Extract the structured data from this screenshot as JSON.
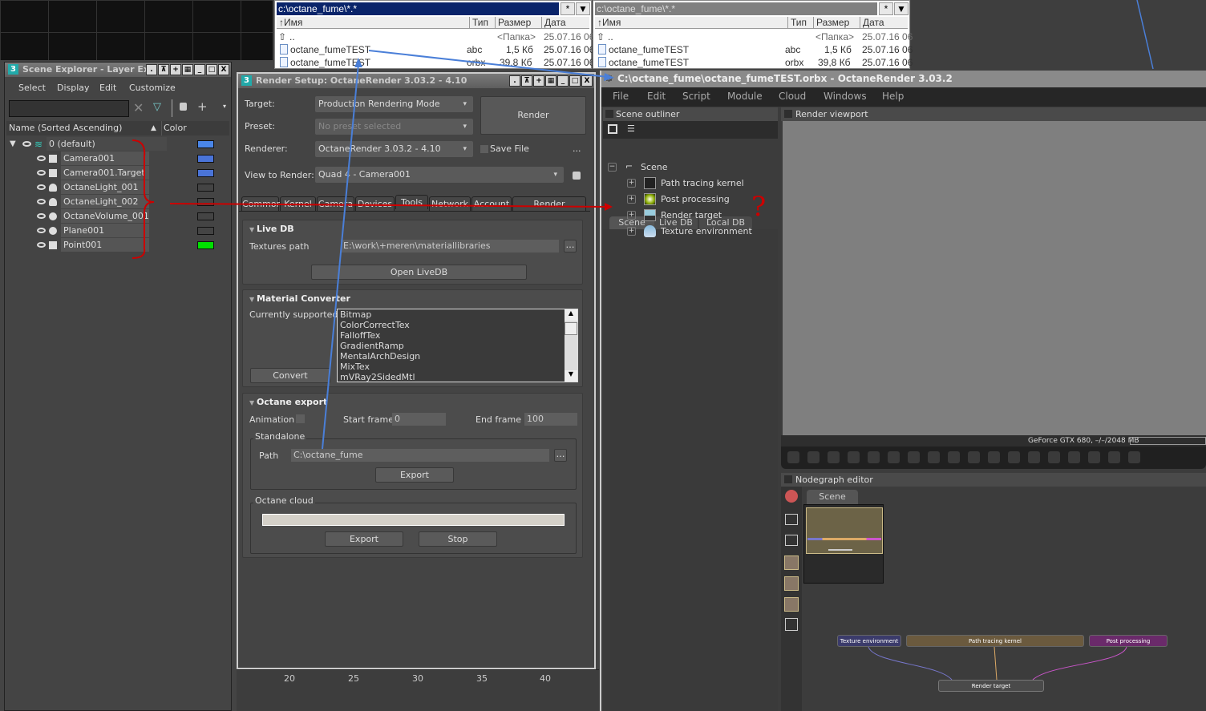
{
  "file_panels": [
    {
      "path": "c:\\octane_fume\\*.*",
      "cols": [
        "↑Имя",
        "Тип",
        "Размер",
        "Дата"
      ],
      "rows": [
        {
          "name": "..",
          "type": "",
          "size": "<Папка>",
          "date": "25.07.16 06"
        },
        {
          "name": "octane_fumeTEST",
          "type": "abc",
          "size": "1,5 Кб",
          "date": "25.07.16 06"
        },
        {
          "name": "octane_fumeTEST",
          "type": "orbx",
          "size": "39,8 Кб",
          "date": "25.07.16 06"
        }
      ]
    },
    {
      "path": "c:\\octane_fume\\*.*",
      "cols": [
        "↑Имя",
        "Тип",
        "Размер",
        "Дата"
      ],
      "rows": [
        {
          "name": "..",
          "type": "",
          "size": "<Папка>",
          "date": "25.07.16 06"
        },
        {
          "name": "octane_fumeTEST",
          "type": "abc",
          "size": "1,5 Кб",
          "date": "25.07.16 06"
        },
        {
          "name": "octane_fumeTEST",
          "type": "orbx",
          "size": "39,8 Кб",
          "date": "25.07.16 06"
        }
      ]
    }
  ],
  "path_btn": "*",
  "dropdown_btn": "▼",
  "scene_explorer": {
    "title": "Scene Explorer - Layer Ex",
    "menu": [
      "Select",
      "Display",
      "Edit",
      "Customize"
    ],
    "search": "",
    "col_name": "Name (Sorted Ascending)",
    "col_color": "Color",
    "rows": [
      {
        "name": "0 (default)",
        "color": "#4a86e8"
      },
      {
        "name": "Camera001",
        "color": "#4a74d8"
      },
      {
        "name": "Camera001.Target",
        "color": "#4a74d8"
      },
      {
        "name": "OctaneLight_001",
        "color": "#444444"
      },
      {
        "name": "OctaneLight_002",
        "color": "#444444"
      },
      {
        "name": "OctaneVolume_001",
        "color": "#444444"
      },
      {
        "name": "Plane001",
        "color": "#444444"
      },
      {
        "name": "Point001",
        "color": "#00e000"
      }
    ]
  },
  "render_setup": {
    "title": "Render Setup: OctaneRender 3.03.2 - 4.10",
    "target_label": "Target:",
    "target": "Production Rendering Mode",
    "preset_label": "Preset:",
    "preset": "No preset selected",
    "renderer_label": "Renderer:",
    "renderer": "OctaneRender 3.03.2 - 4.10",
    "save_file": "Save File",
    "ellipsis": "...",
    "view_label": "View to Render:",
    "view": "Quad 4 - Camera001",
    "render_btn": "Render",
    "tabs": [
      "Common",
      "Kernel",
      "Camera",
      "Devices",
      "Tools",
      "Network",
      "Account",
      "Render Elements"
    ],
    "livedb": {
      "title": "Live DB",
      "textures_label": "Textures path",
      "textures_path": "E:\\work\\+meren\\materiallibraries",
      "open_btn": "Open LiveDB"
    },
    "converter": {
      "title": "Material Converter",
      "supported_label": "Currently supported:",
      "items": [
        "Bitmap",
        "ColorCorrectTex",
        "FalloffTex",
        "GradientRamp",
        "MentalArchDesign",
        "MixTex",
        "mVRay2SidedMtl"
      ],
      "convert_btn": "Convert"
    },
    "export": {
      "title": "Octane export",
      "animation_label": "Animation",
      "start_label": "Start frame",
      "start": "0",
      "end_label": "End frame",
      "end": "100",
      "standalone": "Standalone",
      "path_label": "Path",
      "path": "C:\\octane_fume",
      "export_btn": "Export",
      "cloud": "Octane cloud",
      "cloud_export": "Export",
      "stop": "Stop"
    }
  },
  "timeline": [
    "20",
    "25",
    "30",
    "35",
    "40"
  ],
  "octane": {
    "title": "C:\\octane_fume\\octane_fumeTEST.orbx - OctaneRender 3.03.2",
    "menu": [
      "File",
      "Edit",
      "Script",
      "Module",
      "Cloud",
      "Windows",
      "Help"
    ],
    "outliner_title": "Scene outliner",
    "viewport_title": "Render viewport",
    "tabs": [
      "Scene",
      "Live DB",
      "Local DB"
    ],
    "tree_root": "Scene",
    "tree": [
      "Path tracing kernel",
      "Post processing",
      "Render target",
      "Texture environment"
    ],
    "gpu": "GeForce GTX 680, –/–/2048 MB",
    "nodegraph_title": "Nodegraph editor",
    "nodegraph_tab": "Scene",
    "nodes": {
      "tex": "Texture environment",
      "kernel": "Path tracing kernel",
      "post": "Post processing",
      "rt": "Render target"
    }
  },
  "annotation": {
    "mark": "?"
  }
}
